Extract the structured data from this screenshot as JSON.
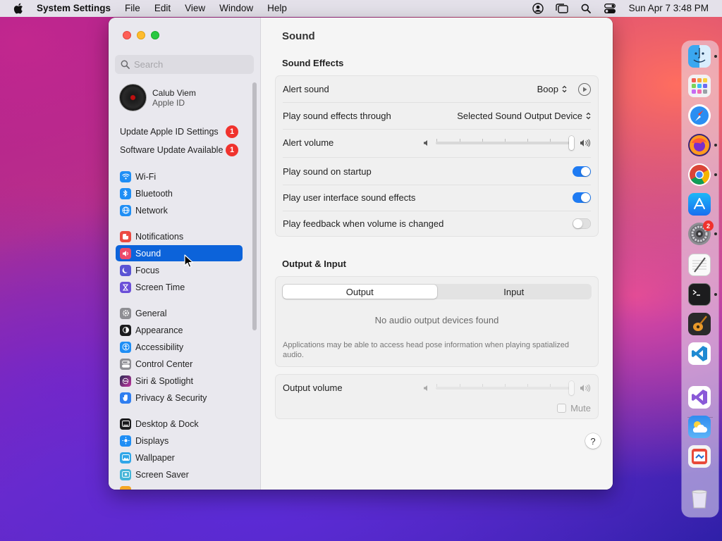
{
  "menubar": {
    "app_name": "System Settings",
    "menus": [
      "File",
      "Edit",
      "View",
      "Window",
      "Help"
    ],
    "clock": "Sun Apr 7  3:48 PM"
  },
  "sidebar": {
    "search_placeholder": "Search",
    "account": {
      "name": "Calub Viem",
      "sub": "Apple ID"
    },
    "notices": [
      {
        "label": "Update Apple ID Settings",
        "badge": "1"
      },
      {
        "label": "Software Update Available",
        "badge": "1"
      }
    ],
    "items": [
      {
        "label": "Wi-Fi",
        "icon": "wifi-icon",
        "color": "#1f8ef5"
      },
      {
        "label": "Bluetooth",
        "icon": "bluetooth-icon",
        "color": "#1f8ef5"
      },
      {
        "label": "Network",
        "icon": "globe-icon",
        "color": "#1f8ef5"
      },
      {
        "label": "Notifications",
        "icon": "bell-icon",
        "color": "#ec4a42"
      },
      {
        "label": "Sound",
        "icon": "speaker-icon",
        "color": "#ec4a6a"
      },
      {
        "label": "Focus",
        "icon": "moon-icon",
        "color": "#5b54d4"
      },
      {
        "label": "Screen Time",
        "icon": "hourglass-icon",
        "color": "#6b4fd8"
      },
      {
        "label": "General",
        "icon": "gear-icon",
        "color": "#8e8e93"
      },
      {
        "label": "Appearance",
        "icon": "appearance-icon",
        "color": "#1c1c1e"
      },
      {
        "label": "Accessibility",
        "icon": "accessibility-icon",
        "color": "#1f8ef5"
      },
      {
        "label": "Control Center",
        "icon": "control-center-icon",
        "color": "#8e8e93"
      },
      {
        "label": "Siri & Spotlight",
        "icon": "siri-icon",
        "color": "#2b2b55"
      },
      {
        "label": "Privacy & Security",
        "icon": "hand-icon",
        "color": "#2f7ef0"
      },
      {
        "label": "Desktop & Dock",
        "icon": "dock-icon",
        "color": "#1c1c1e"
      },
      {
        "label": "Displays",
        "icon": "sun-icon",
        "color": "#1f8ef5"
      },
      {
        "label": "Wallpaper",
        "icon": "wallpaper-icon",
        "color": "#2fa6e8"
      },
      {
        "label": "Screen Saver",
        "icon": "screensaver-icon",
        "color": "#45b5d8"
      }
    ]
  },
  "main": {
    "title": "Sound",
    "sound_effects": {
      "heading": "Sound Effects",
      "alert_sound": {
        "label": "Alert sound",
        "value": "Boop"
      },
      "play_through": {
        "label": "Play sound effects through",
        "value": "Selected Sound Output Device"
      },
      "alert_volume": {
        "label": "Alert volume",
        "level": 1.0
      },
      "startup": {
        "label": "Play sound on startup",
        "on": true
      },
      "ui_sounds": {
        "label": "Play user interface sound effects",
        "on": true
      },
      "feedback": {
        "label": "Play feedback when volume is changed",
        "on": false
      }
    },
    "output_input": {
      "heading": "Output & Input",
      "tabs": [
        "Output",
        "Input"
      ],
      "empty": "No audio output devices found",
      "head_pose": "Applications may be able to access head pose information when playing spatialized audio."
    },
    "output_volume": {
      "label": "Output volume",
      "level": 1.0,
      "mute_label": "Mute"
    },
    "help_label": "?"
  },
  "dock": {
    "apps": [
      "finder",
      "launchpad",
      "safari",
      "firefox",
      "chrome",
      "app-store",
      "system-settings",
      "textedit",
      "terminal",
      "garageband",
      "vscode",
      "visual-studio",
      "weather",
      "remote-desktop",
      "trash"
    ],
    "settings_badge": "2"
  },
  "colors": {
    "accent": "#0c63da",
    "toggle_on": "#1f7bf2",
    "badge": "#f0322d"
  }
}
